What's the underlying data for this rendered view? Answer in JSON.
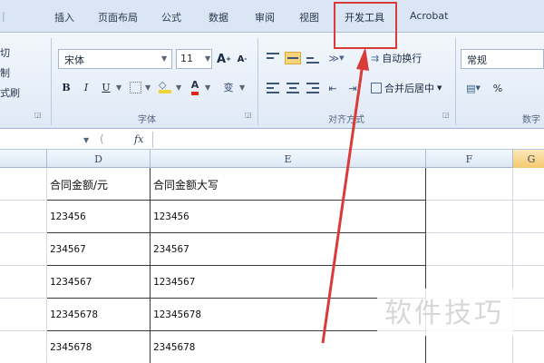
{
  "ribbon_tabs": [
    {
      "label": "插入"
    },
    {
      "label": "页面布局"
    },
    {
      "label": "公式"
    },
    {
      "label": "数据"
    },
    {
      "label": "审阅"
    },
    {
      "label": "视图"
    },
    {
      "label": "开发工具"
    },
    {
      "label": "Acrobat"
    }
  ],
  "clipboard": {
    "cut": "切",
    "copy": "制",
    "format_painter": "式刷"
  },
  "font": {
    "name": "宋体",
    "size": "11",
    "grow": "A",
    "shrink": "A",
    "bold": "B",
    "italic": "I",
    "underline": "U",
    "font_color": "A",
    "phonetic": "变",
    "group_label": "字体"
  },
  "alignment": {
    "wrap_text": "自动换行",
    "merge_center": "合并后居中",
    "group_label": "对齐方式"
  },
  "number": {
    "format": "常规",
    "percent": "%",
    "group_label": "数字"
  },
  "formula_bar": {
    "fx": "fx",
    "content": ""
  },
  "columns": [
    {
      "label": "D"
    },
    {
      "label": "E"
    },
    {
      "label": "F"
    },
    {
      "label": "G"
    }
  ],
  "rows": [
    {
      "d": "合同金额/元",
      "e": "合同金额大写"
    },
    {
      "d": "123456",
      "e": "123456"
    },
    {
      "d": "234567",
      "e": "234567"
    },
    {
      "d": "1234567",
      "e": "1234567"
    },
    {
      "d": "12345678",
      "e": "12345678"
    },
    {
      "d": "2345678",
      "e": "2345678"
    }
  ],
  "watermark": "软件技巧",
  "colors": {
    "annotation_red": "#d93b3b",
    "selected_col": "#f5c870"
  }
}
